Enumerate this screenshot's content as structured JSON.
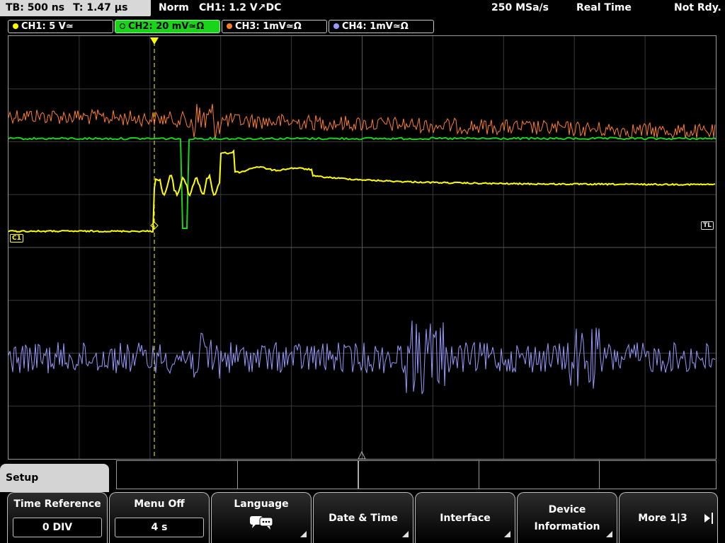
{
  "status": {
    "timebase": "TB: 500 ns",
    "trigger_time": "T: 1.47 µs",
    "mode": "Norm",
    "trigger_source": "CH1: 1.2 V",
    "trigger_symbol": "↗",
    "coupling": "DC",
    "sample_rate": "250 MSa/s",
    "acquisition": "Real Time",
    "ready_state": "Not Rdy."
  },
  "channels": [
    {
      "label": "CH1: 5 V≃",
      "color": "#ffff00",
      "active": false
    },
    {
      "label": "CH2: 20 mV≃Ω",
      "color": "#19d419",
      "active": true
    },
    {
      "label": "CH3: 1mV≃Ω",
      "color": "#ff7f27",
      "active": false
    },
    {
      "label": "CH4: 1mV≃Ω",
      "color": "#9999ff",
      "active": false
    }
  ],
  "markers": {
    "ch1": "C1",
    "trigger_level": "TL"
  },
  "menu": {
    "title": "Setup",
    "time_reference_label": "Time Reference",
    "time_reference_value": "0 DIV",
    "menu_off_label": "Menu Off",
    "menu_off_value": "4 s",
    "language_label": "Language",
    "language_icon": "speech-bubbles-icon",
    "date_time_label": "Date & Time",
    "interface_label": "Interface",
    "device_info_line1": "Device",
    "device_info_line2": "Information",
    "more_label": "More 1|3"
  }
}
